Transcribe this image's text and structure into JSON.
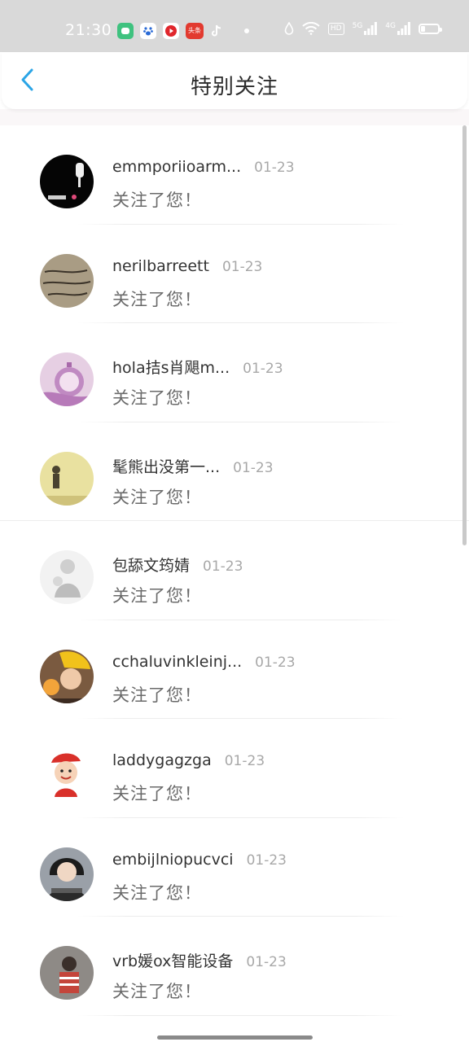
{
  "status_bar": {
    "time": "21:30",
    "apps": [
      "wechat-icon",
      "baidu-icon",
      "video-icon",
      "toutiao-icon",
      "tiktok-icon"
    ],
    "toutiao_label": "头条",
    "hd": "HD",
    "sig1": "5G",
    "sig2": "4G"
  },
  "header": {
    "title": "特别关注"
  },
  "colors": {
    "accent": "#2ba5e6",
    "date": "#a8a8a8"
  },
  "list": [
    {
      "name": "emmporiioarm...",
      "date": "01-23",
      "message": "关注了您！"
    },
    {
      "name": "nerilbarreett",
      "date": "01-23",
      "message": "关注了您！"
    },
    {
      "name": "hola拮s肖飓m...",
      "date": "01-23",
      "message": "关注了您！"
    },
    {
      "name": "髦熊出没第一...",
      "date": "01-23",
      "message": "关注了您！"
    },
    {
      "name": "包舔文筠婧",
      "date": "01-23",
      "message": "关注了您！"
    },
    {
      "name": "cchaluvinkleinj...",
      "date": "01-23",
      "message": "关注了您！"
    },
    {
      "name": "laddygagzga",
      "date": "01-23",
      "message": "关注了您！"
    },
    {
      "name": "embijlniopucvci",
      "date": "01-23",
      "message": "关注了您！"
    },
    {
      "name": "vrb媛ox智能设备",
      "date": "01-23",
      "message": "关注了您！"
    }
  ]
}
